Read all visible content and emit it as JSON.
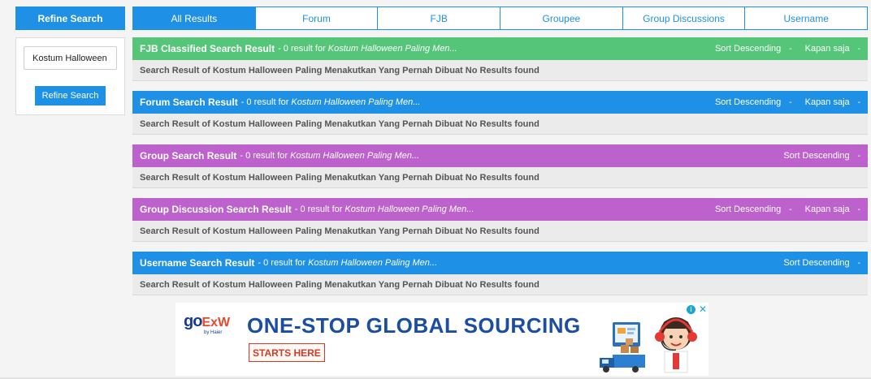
{
  "sidebar": {
    "header": "Refine Search",
    "search_value": "Kostum Halloween",
    "button_label": "Refine Search"
  },
  "tabs": [
    {
      "label": "All Results",
      "active": true
    },
    {
      "label": "Forum",
      "active": false
    },
    {
      "label": "FJB",
      "active": false
    },
    {
      "label": "Groupee",
      "active": false
    },
    {
      "label": "Group Discussions",
      "active": false
    },
    {
      "label": "Username",
      "active": false
    }
  ],
  "sections": [
    {
      "title": "FJB Classified Search Result",
      "subtitle": "- 0 result for",
      "query": "Kostum Halloween Paling Men...",
      "color": "#55c57a",
      "sort_label": "Sort Descending",
      "sort_caret": "-",
      "time_label": "Kapan saja",
      "time_caret": "-",
      "body": "Search Result of Kostum Halloween Paling Menakutkan Yang Pernah Dibuat No Results found"
    },
    {
      "title": "Forum Search Result",
      "subtitle": "- 0 result for",
      "query": "Kostum Halloween Paling Men...",
      "color": "#1e90e6",
      "sort_label": "Sort Descending",
      "sort_caret": "-",
      "time_label": "Kapan saja",
      "time_caret": "-",
      "body": "Search Result of Kostum Halloween Paling Menakutkan Yang Pernah Dibuat No Results found"
    },
    {
      "title": "Group Search Result",
      "subtitle": "- 0 result for",
      "query": "Kostum Halloween Paling Men...",
      "color": "#bd62cc",
      "sort_label": "Sort Descending",
      "sort_caret": "-",
      "body": "Search Result of Kostum Halloween Paling Menakutkan Yang Pernah Dibuat No Results found"
    },
    {
      "title": "Group Discussion Search Result",
      "subtitle": "- 0 result for",
      "query": "Kostum Halloween Paling Men...",
      "color": "#bd62cc",
      "sort_label": "Sort Descending",
      "sort_caret": "-",
      "time_label": "Kapan saja",
      "time_caret": "-",
      "body": "Search Result of Kostum Halloween Paling Menakutkan Yang Pernah Dibuat No Results found"
    },
    {
      "title": "Username Search Result",
      "subtitle": "- 0 result for",
      "query": "Kostum Halloween Paling Men...",
      "color": "#1e90e6",
      "sort_label": "Sort Descending",
      "sort_caret": "-",
      "body": "Search Result of Kostum Halloween Paling Menakutkan Yang Pernah Dibuat No Results found"
    }
  ],
  "ad": {
    "logo_main": "go",
    "logo_ex": "ExW",
    "logo_by": "by Haier",
    "headline": "ONE-STOP GLOBAL SOURCING",
    "cta": "STARTS HERE",
    "info_glyph": "i",
    "close_glyph": "✕"
  }
}
